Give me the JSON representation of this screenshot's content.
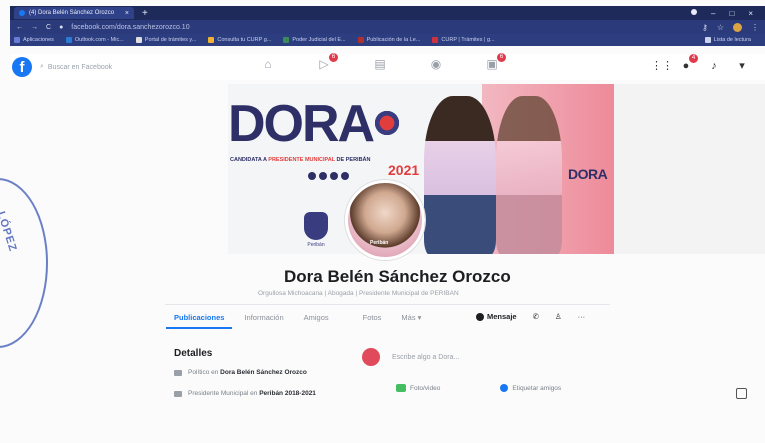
{
  "browser": {
    "tab_title": "(4) Dora Belén Sánchez Orozco",
    "url": "facebook.com/dora.sanchezorozco.10",
    "bookmarks": [
      {
        "label": "Aplicaciones",
        "color": "#6a7bd6"
      },
      {
        "label": "Outlook.com - Mic...",
        "color": "#2a7bd6"
      },
      {
        "label": "Portal de trámites y...",
        "color": "#e0e0e0"
      },
      {
        "label": "Consulta tu CURP g...",
        "color": "#f0b030"
      },
      {
        "label": "Poder Judicial del E...",
        "color": "#3a8a5a"
      },
      {
        "label": "Publicación de la Le...",
        "color": "#b03030"
      },
      {
        "label": "CURP | Trámites | g...",
        "color": "#d03040"
      }
    ],
    "reading_list": "Lista de lectura"
  },
  "facebook": {
    "search_placeholder": "Buscar en Facebook",
    "nav_badges": {
      "watch": "6",
      "gaming": "6"
    },
    "messenger_badge": "4"
  },
  "cover": {
    "brand": "DORA",
    "subtitle_prefix": "CANDIDATA A ",
    "subtitle_highlight": "PRESIDENTE MUNICIPAL",
    "subtitle_suffix": " DE PERIBÁN",
    "year": "2021",
    "side_brand": "DORA",
    "emblem_label": "Peribán",
    "profile_label": "Peribán"
  },
  "profile": {
    "name": "Dora Belén Sánchez Orozco",
    "bio": "Orgullosa Michoacana | Abogada | Presidente Municipal de PERIBAN"
  },
  "tabs": [
    "Publicaciones",
    "Información",
    "Amigos",
    "Fotos",
    "Más ▾"
  ],
  "actions": {
    "message": "Mensaje"
  },
  "details": {
    "title": "Detalles",
    "rows": [
      {
        "prefix": "Político en ",
        "bold": "Dora Belén Sánchez Orozco"
      },
      {
        "prefix": "Presidente Municipal en ",
        "bold": "Peribán 2018-2021"
      }
    ]
  },
  "composer": {
    "placeholder": "Escribe algo a Dora...",
    "photo_video": "Foto/video",
    "tag_friends": "Etiquetar amigos"
  },
  "stamp": {
    "text": "LÓPEZ"
  }
}
